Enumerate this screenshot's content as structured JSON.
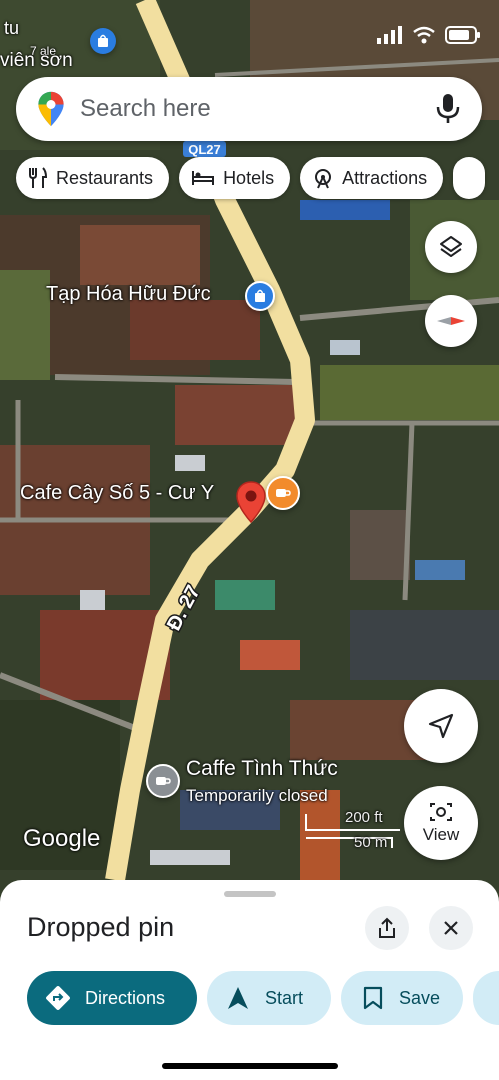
{
  "search": {
    "placeholder": "Search here"
  },
  "chips": [
    {
      "label": "Restaurants",
      "icon": "fork-knife-icon"
    },
    {
      "label": "Hotels",
      "icon": "bed-icon"
    },
    {
      "label": "Attractions",
      "icon": "ferris-wheel-icon"
    }
  ],
  "map": {
    "road_badge": "QL27",
    "road_name": "Đ. 27",
    "top_label_1": "tu",
    "top_label_2": "viên sơn",
    "top_label_3": "7 ale",
    "poi_store": "Tạp Hóa Hữu Đức",
    "poi_cafe": "Cafe Cây Số 5 - Cư Y",
    "poi_caffe": "Caffe Tình Thức",
    "poi_caffe_status": "Temporarily closed",
    "watermark": "Google",
    "scale_ft": "200 ft",
    "scale_m": "50 m"
  },
  "buttons": {
    "view_label": "View"
  },
  "sheet": {
    "title": "Dropped pin",
    "actions": [
      {
        "label": "Directions",
        "icon": "directions-icon"
      },
      {
        "label": "Start",
        "icon": "navigation-arrow-icon"
      },
      {
        "label": "Save",
        "icon": "bookmark-icon"
      }
    ]
  },
  "colors": {
    "accent": "#1a73e8",
    "directions_bg": "#0b6b7e",
    "action_bg": "#d2ecf6",
    "action_text": "#064d5c",
    "road": "#f2dfa0",
    "pin_red": "#ea4335",
    "cafe_orange": "#f28b2c"
  }
}
